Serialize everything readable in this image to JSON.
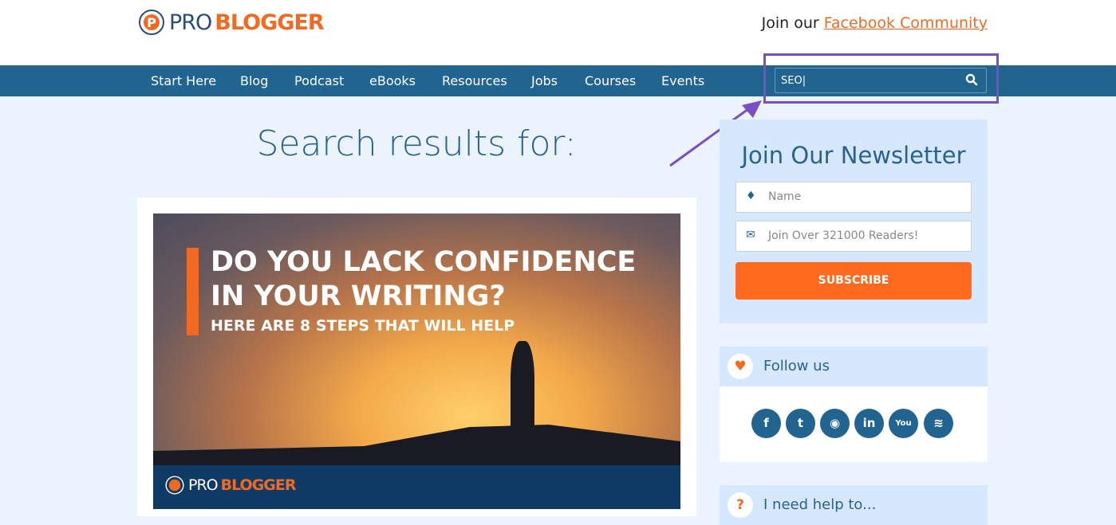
{
  "header": {
    "logo_pro": "PRO",
    "logo_blogger": "BLOGGER",
    "join_text": "Join our ",
    "join_link": "Facebook Community"
  },
  "nav": {
    "items": [
      "Start Here",
      "Blog",
      "Podcast",
      "eBooks",
      "Resources",
      "Jobs",
      "Courses",
      "Events"
    ]
  },
  "search": {
    "value": "SEO",
    "icon": "search-icon"
  },
  "main": {
    "title": "Search results for:",
    "post": {
      "headline_line1": "DO YOU LACK CONFIDENCE",
      "headline_line2": "IN YOUR WRITING?",
      "subheadline": "HERE ARE 8 STEPS THAT WILL HELP",
      "brand_pro": "PRO",
      "brand_blogger": "BLOGGER"
    }
  },
  "sidebar": {
    "newsletter": {
      "title": "Join Our Newsletter",
      "name_placeholder": "Name",
      "email_placeholder": "Join Over 321000 Readers!",
      "subscribe": "SUBSCRIBE"
    },
    "follow": {
      "title": "Follow us",
      "icons": [
        "facebook",
        "twitter",
        "podcast",
        "linkedin",
        "youtube",
        "rss"
      ]
    },
    "help": {
      "title": "I need help to..."
    }
  },
  "annotation": {
    "color": "#7a4fc0"
  },
  "colors": {
    "nav": "#21648f",
    "accent": "#f26a21"
  }
}
